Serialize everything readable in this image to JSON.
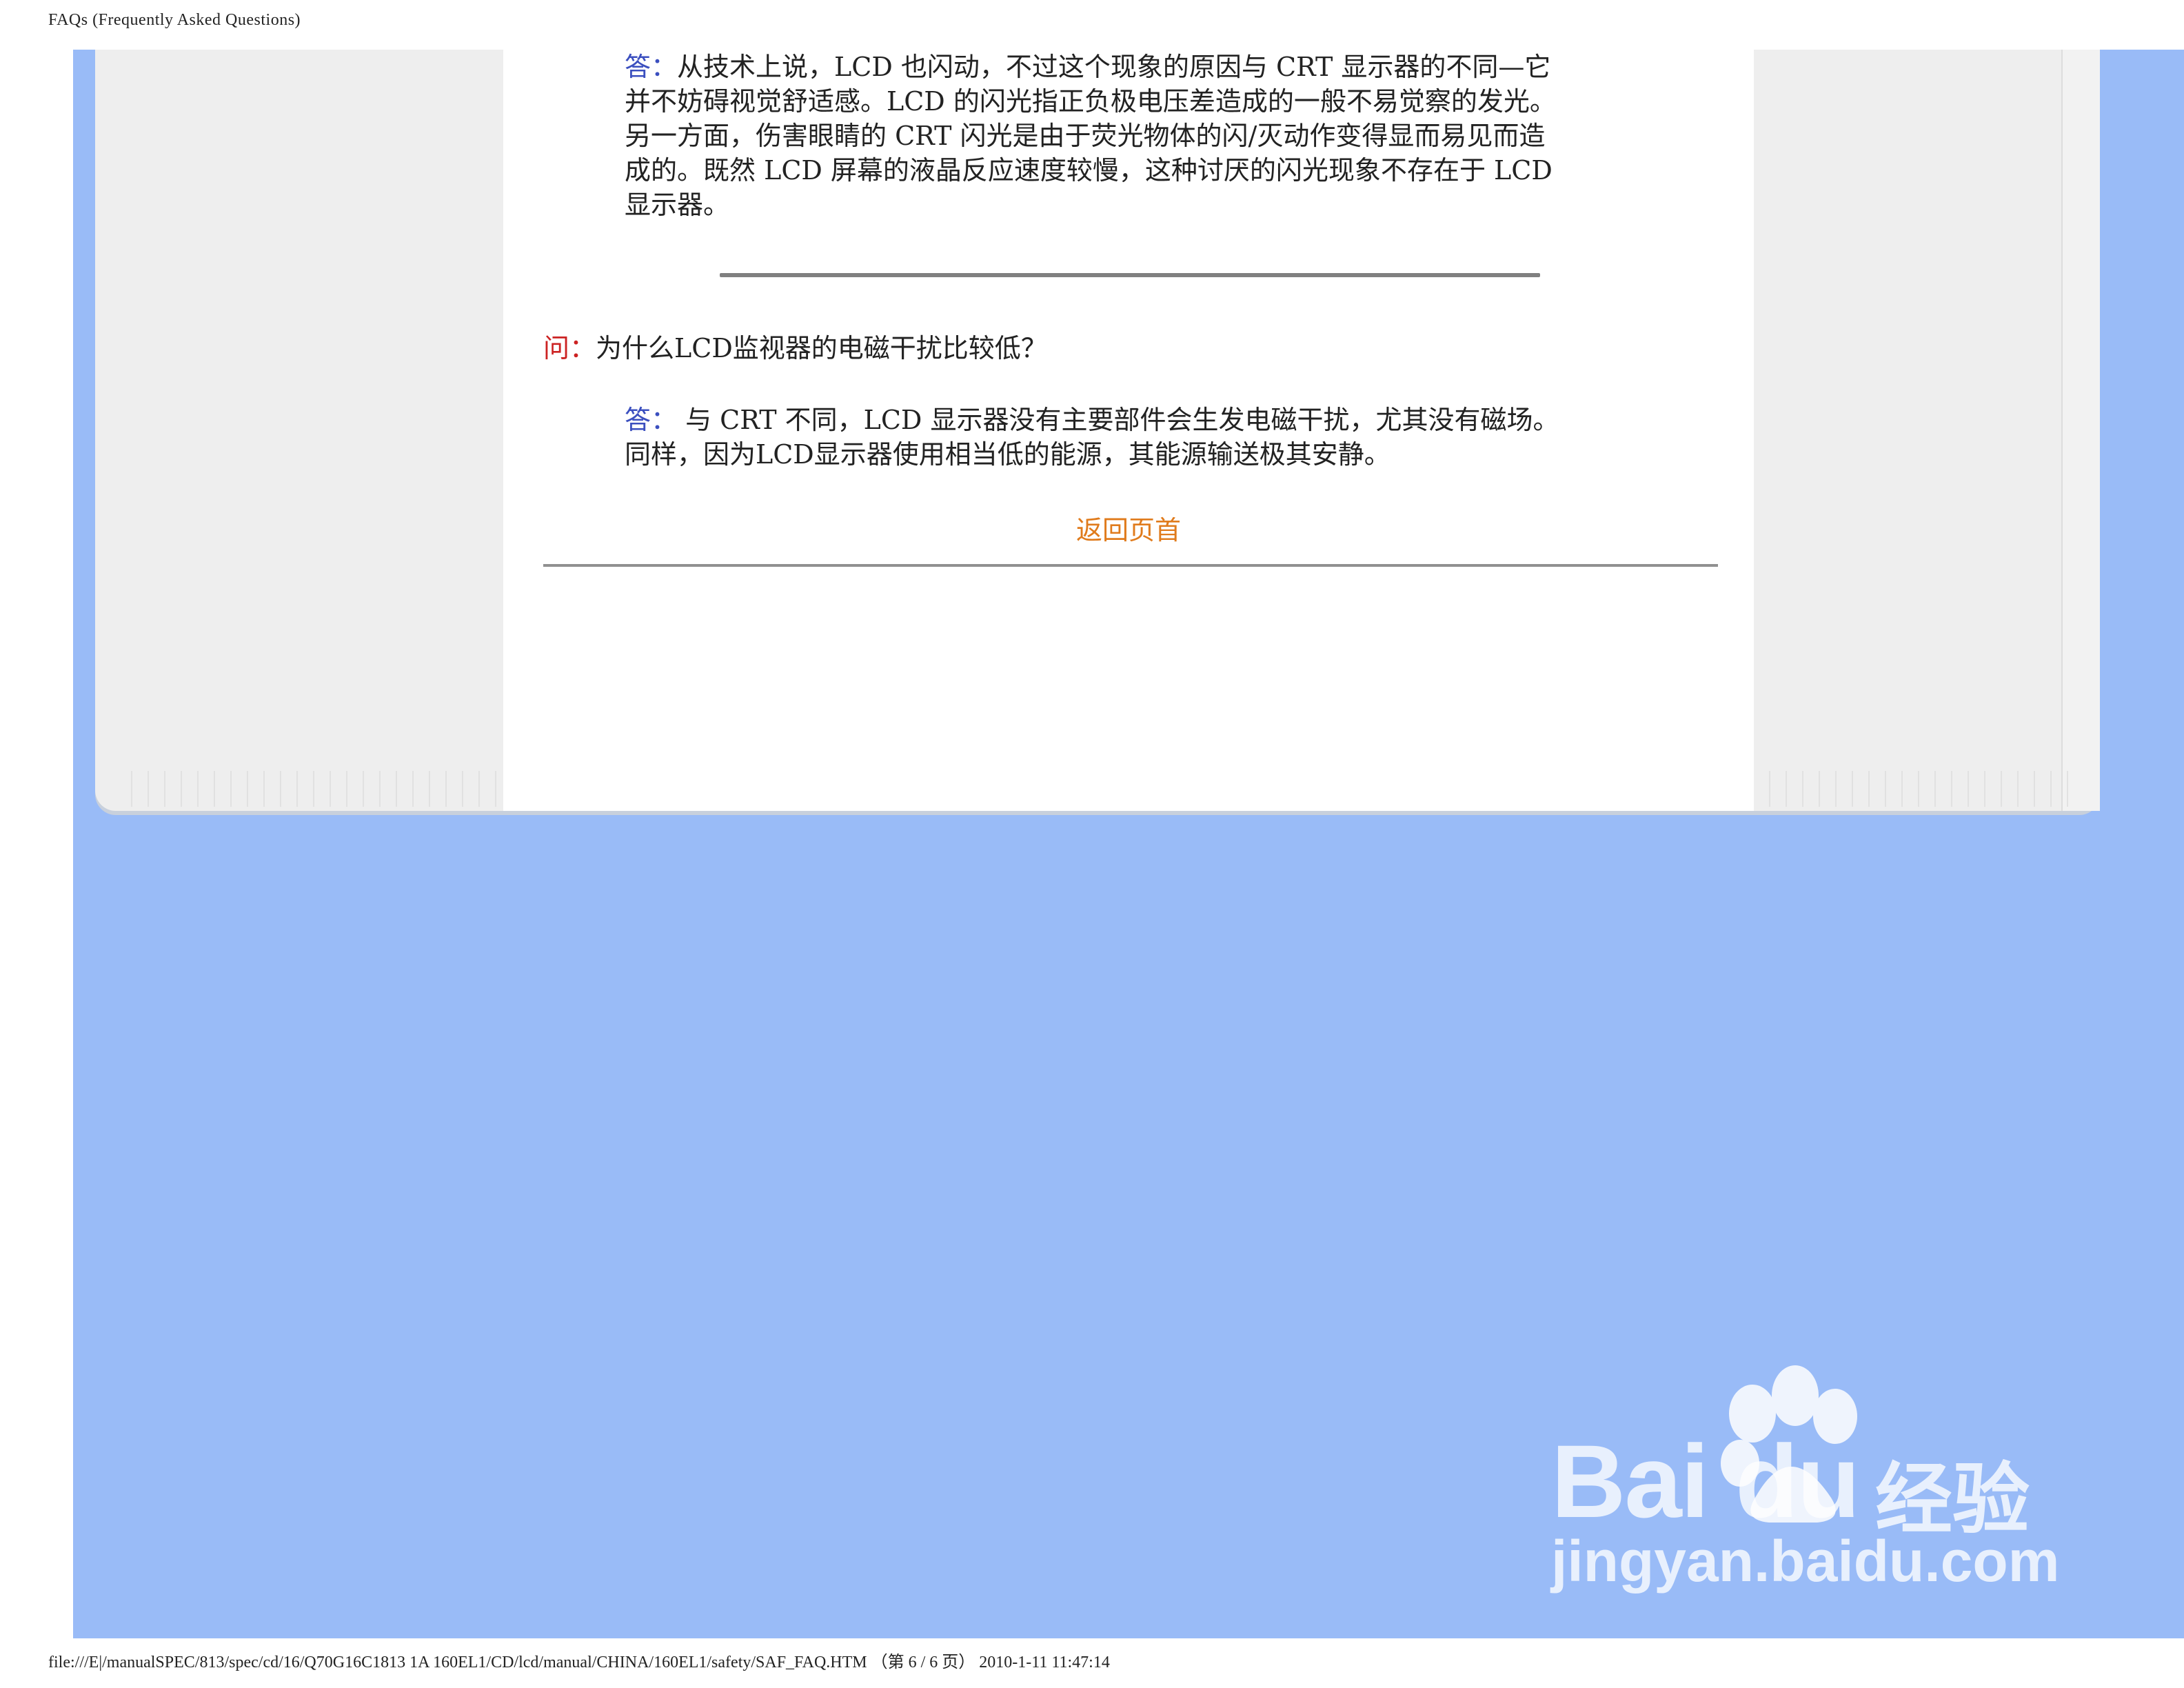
{
  "header": {
    "title": "FAQs (Frequently Asked Questions)"
  },
  "answer_1": {
    "tag": "答：",
    "lines": [
      "从技术上说，LCD 也闪动，不过这个现象的原因与 CRT 显示器的不同—它",
      "并不妨碍视觉舒适感。LCD 的闪光指正负极电压差造成的一般不易觉察的发光。",
      "另一方面，伤害眼睛的 CRT 闪光是由于荧光物体的闪/灭动作变得显而易见而造",
      "成的。既然 LCD 屏幕的液晶反应速度较慢，这种讨厌的闪光现象不存在于 LCD",
      "显示器。"
    ]
  },
  "question_2": {
    "tag": "问：",
    "text": "为什么LCD监视器的电磁干扰比较低？"
  },
  "answer_2": {
    "tag": "答：",
    "lines": [
      " 与 CRT 不同，LCD 显示器没有主要部件会生发电磁干扰，尤其没有磁场。",
      "同样，因为LCD显示器使用相当低的能源，其能源输送极其安静。"
    ]
  },
  "back_to_top": "返回页首",
  "watermark": {
    "brand": "Bai du",
    "cn": "经验",
    "domain": "jingyan.baidu.com"
  },
  "footer": {
    "path": "file:///E|/manualSPEC/813/spec/cd/16/Q70G16C1813 1A 160EL1/CD/lcd/manual/CHINA/160EL1/safety/SAF_FAQ.HTM",
    "page": "（第 6 / 6 页）",
    "datetime": "2010-1-11 11:47:14"
  },
  "colors": {
    "background_blue": "#99bbf7",
    "answer_tag": "#3b4fbf",
    "question_tag": "#cc2222",
    "link": "#e07b1c"
  }
}
